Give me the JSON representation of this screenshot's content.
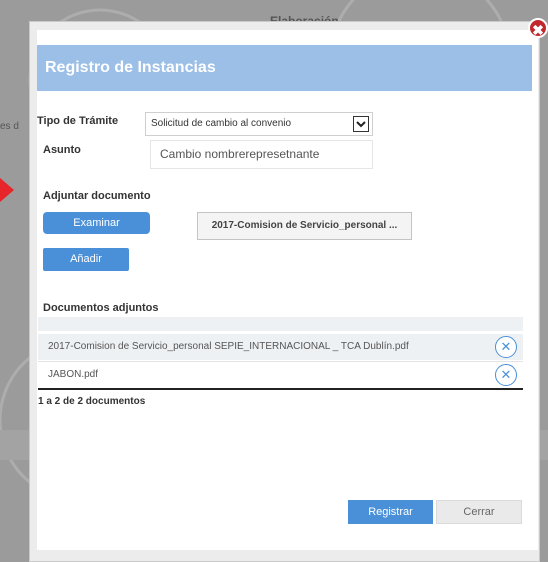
{
  "background": {
    "header_text": "Elaboración",
    "side_text": "es d"
  },
  "modal": {
    "title": "Registro de Instancias",
    "close_symbol": "✖",
    "tipo_tramite": {
      "label": "Tipo de Trámite",
      "selected": "Solicitud de cambio al convenio"
    },
    "asunto": {
      "label": "Asunto",
      "value": "Cambio nombrerepresetnante"
    },
    "adjuntar": {
      "label": "Adjuntar documento",
      "examinar_label": "Examinar",
      "file_name": "2017-Comision de Servicio_personal ...",
      "anadir_label": "Añadir"
    },
    "documentos": {
      "label": "Documentos adjuntos",
      "rows": [
        {
          "name": "2017-Comision de Servicio_personal SEPIE_INTERNACIONAL _ TCA Dublín.pdf"
        },
        {
          "name": "JABON.pdf"
        }
      ],
      "pager": "1 a 2 de 2 documentos"
    },
    "footer": {
      "registrar_label": "Registrar",
      "cerrar_label": "Cerrar"
    }
  },
  "colors": {
    "accent": "#4a90d9",
    "title_bar": "#9bbfe6",
    "close": "#c1272d"
  },
  "icons": {
    "close": "close-icon",
    "remove": "remove-circle-icon",
    "dropdown": "chevron-down-icon"
  }
}
